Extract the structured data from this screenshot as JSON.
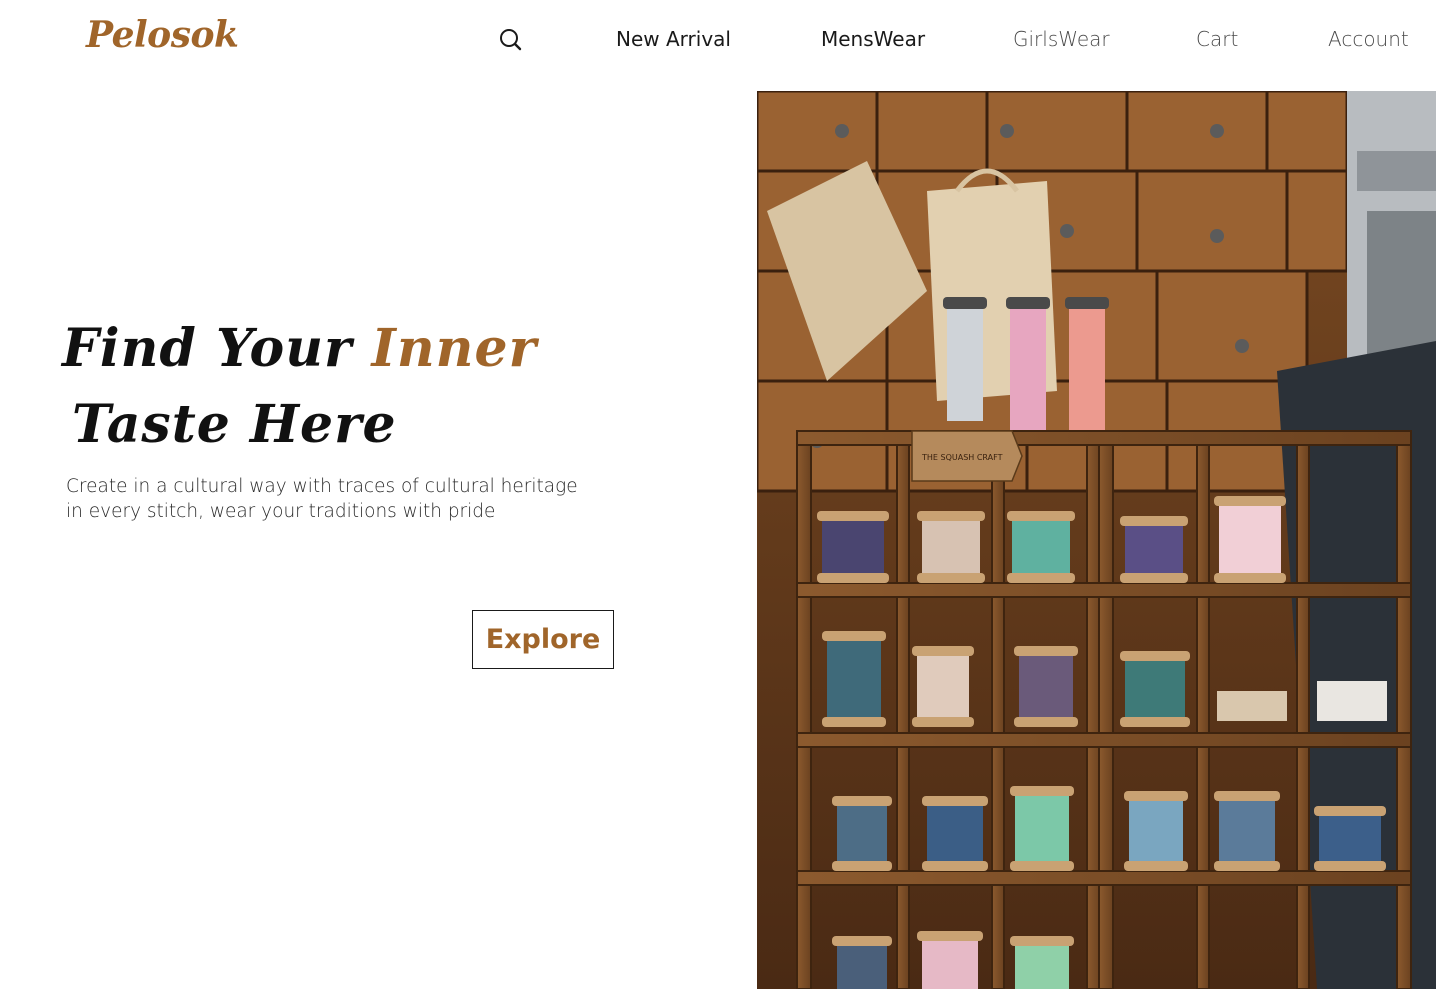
{
  "brand": {
    "logo": "Pelosok"
  },
  "nav": {
    "search_icon": "search-icon",
    "items": [
      {
        "label": "New Arrival"
      },
      {
        "label": "MensWear"
      },
      {
        "label": "GirlsWear"
      },
      {
        "label": "Cart"
      },
      {
        "label": "Account"
      }
    ]
  },
  "hero": {
    "line1_prefix": "Find Your",
    "line1_accent": "Inner",
    "line2": "Taste Here",
    "subtitle_line1": "Create in a cultural way with traces of cultural heritage",
    "subtitle_line2": "in every stitch, wear your traditions with pride",
    "cta_label": "Explore",
    "image_tag": "THE SQUASH CRAFT"
  },
  "colors": {
    "accent": "#a0652a",
    "text": "#1a1a1a",
    "wood": "#8a5a30",
    "background": "#ffffff"
  }
}
